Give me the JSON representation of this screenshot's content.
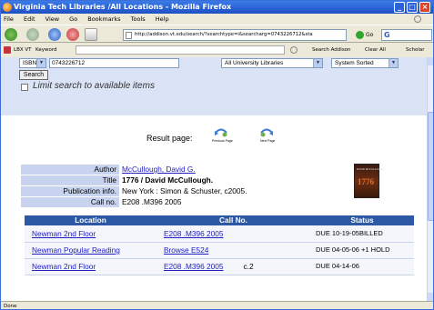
{
  "window": {
    "title": "Virginia Tech Libraries /All Locations - Mozilla Firefox"
  },
  "menu": [
    "File",
    "Edit",
    "View",
    "Go",
    "Bookmarks",
    "Tools",
    "Help"
  ],
  "navbar": {
    "url": "http://addison.vt.edu/search/?searchtype=i&searcharg=0743226712&sta",
    "go_label": "Go",
    "search_box": "G"
  },
  "linkbar": {
    "lib_label": "LBX VT",
    "keyword_label": "Keyword",
    "search_addison": "Search Addison",
    "clear_all": "Clear All",
    "scholar": "Scholar"
  },
  "search": {
    "type": "ISBN/ISSN",
    "query": "0743226712",
    "scope": "All University Libraries",
    "sort": "System Sorted",
    "button": "Search",
    "limit_label": "Limit search to available items"
  },
  "result_page": {
    "label": "Result page:",
    "prev": "Previous Page",
    "next": "Next Page"
  },
  "record": {
    "author_label": "Author",
    "author": "McCullough, David G.",
    "title_label": "Title",
    "title": "1776 / David McCullough.",
    "pub_label": "Publication info.",
    "pub": "New York : Simon & Schuster, c2005.",
    "call_label": "Call no.",
    "call": "E208 .M396 2005"
  },
  "cover": {
    "title": "1776",
    "author": "DAVID McCULLOUGH"
  },
  "holdings": {
    "headers": [
      "Location",
      "Call No.",
      "Status"
    ],
    "rows": [
      {
        "location": "Newman 2nd Floor",
        "call": "E208 .M396 2005",
        "extra": "",
        "status": "DUE 10-19-05BILLED"
      },
      {
        "location": "Newman Popular Reading",
        "call": "Browse E524",
        "extra": "",
        "status": "DUE 04-05-06 +1 HOLD"
      },
      {
        "location": "Newman 2nd Floor",
        "call": "E208 .M396 2005",
        "extra": "c.2",
        "status": "DUE 04-14-06"
      }
    ]
  },
  "status_bar": "Done"
}
